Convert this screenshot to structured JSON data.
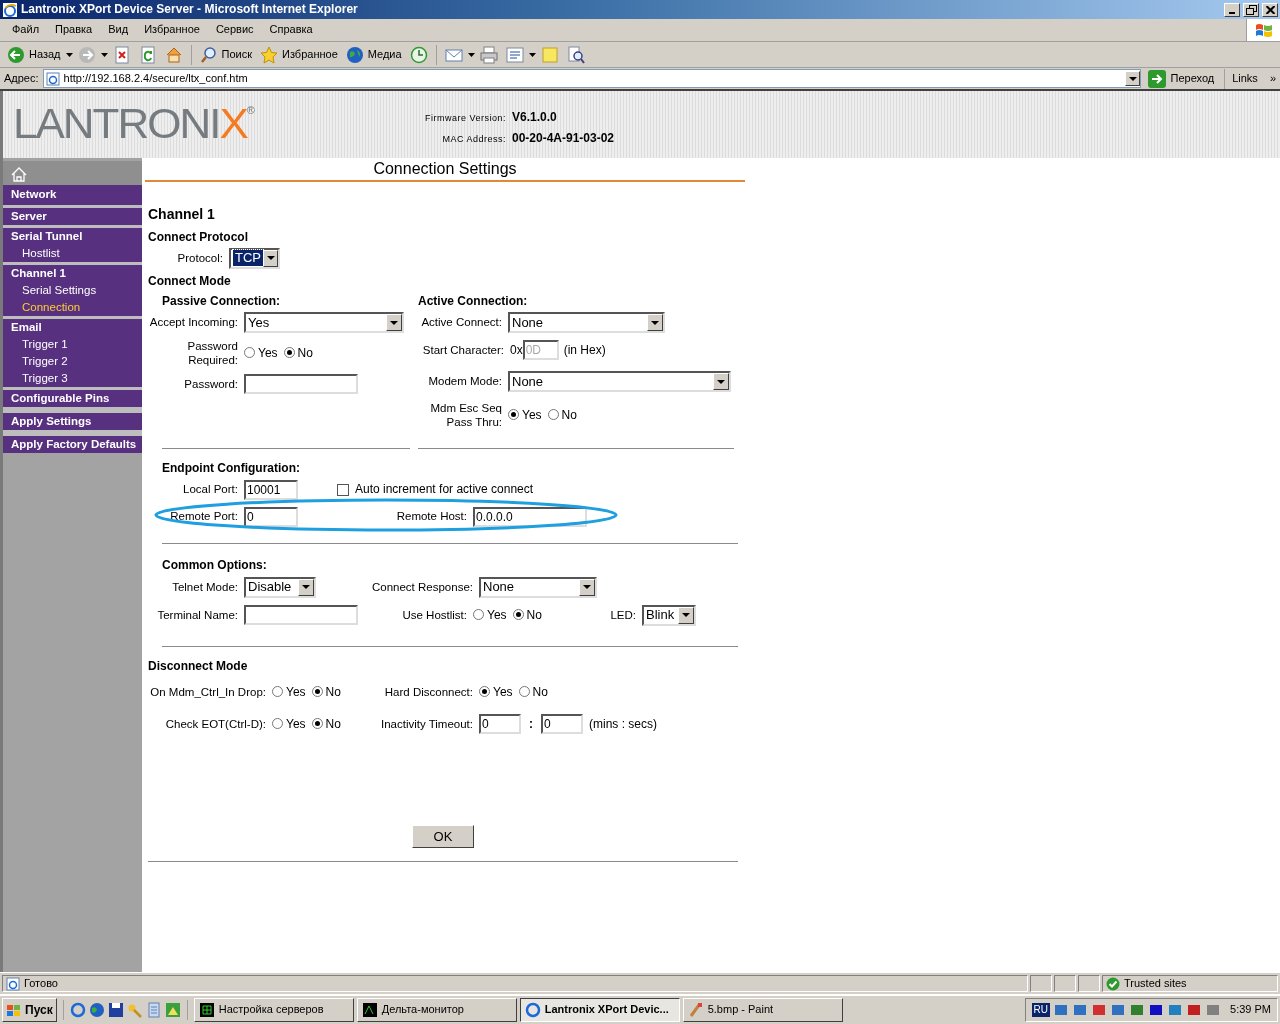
{
  "window": {
    "title": "Lantronix XPort Device Server - Microsoft Internet Explorer"
  },
  "menu": [
    "Файл",
    "Правка",
    "Вид",
    "Избранное",
    "Сервис",
    "Справка"
  ],
  "toolbar": [
    {
      "kind": "back",
      "label": "Назад"
    },
    {
      "kind": "forward"
    },
    {
      "kind": "stop"
    },
    {
      "kind": "refresh"
    },
    {
      "kind": "home"
    },
    {
      "kind": "search",
      "label": "Поиск"
    },
    {
      "kind": "favorites",
      "label": "Избранное"
    },
    {
      "kind": "media",
      "label": "Медиа"
    },
    {
      "kind": "history"
    },
    {
      "kind": "mail"
    },
    {
      "kind": "print"
    },
    {
      "kind": "edit"
    },
    {
      "kind": "note"
    },
    {
      "kind": "research"
    }
  ],
  "address": {
    "label": "Адрес:",
    "url": "http://192.168.2.4/secure/ltx_conf.htm",
    "go": "Переход",
    "links": "Links",
    "more": "»"
  },
  "header": {
    "logo": {
      "text": "LANTRONI",
      "accent": "X",
      "mark": "®"
    },
    "firmware_label": "Firmware Version:",
    "firmware": "V6.1.0.0",
    "mac_label": "MAC Address:",
    "mac": "00-20-4A-91-03-02"
  },
  "sidebar": {
    "items": [
      {
        "kind": "home",
        "selected": false
      },
      {
        "kind": "section",
        "label": "Network",
        "selected": false
      },
      {
        "kind": "section",
        "label": "Server",
        "selected": false
      },
      {
        "kind": "section",
        "label": "Serial Tunnel",
        "selected": false
      },
      {
        "kind": "sub",
        "label": "Hostlist",
        "selected": false
      },
      {
        "kind": "section",
        "label": "Channel 1",
        "selected": false
      },
      {
        "kind": "sub",
        "label": "Serial Settings",
        "selected": false
      },
      {
        "kind": "sub",
        "label": "Connection",
        "selected": true
      },
      {
        "kind": "section",
        "label": "Email",
        "selected": false
      },
      {
        "kind": "sub",
        "label": "Trigger 1",
        "selected": false
      },
      {
        "kind": "sub",
        "label": "Trigger 2",
        "selected": false
      },
      {
        "kind": "sub",
        "label": "Trigger 3",
        "selected": false
      },
      {
        "kind": "section",
        "label": "Configurable Pins",
        "selected": false
      },
      {
        "kind": "action",
        "label": "Apply Settings",
        "selected": false
      },
      {
        "kind": "action",
        "label": "Apply Factory Defaults",
        "selected": false
      }
    ]
  },
  "page_title": "Connection Settings",
  "form": {
    "channel": "Channel 1",
    "protocol_heading": "Connect Protocol",
    "protocol": {
      "label": "Protocol:",
      "value": "TCP",
      "highlighted": true
    },
    "mode_heading": "Connect Mode",
    "passive": {
      "heading": "Passive Connection:",
      "accept_incoming": {
        "label": "Accept Incoming:",
        "value": "Yes"
      },
      "password_required": {
        "label": "Password Required:",
        "options": [
          {
            "label": "Yes",
            "selected": false
          },
          {
            "label": "No",
            "selected": true
          }
        ]
      },
      "password": {
        "label": "Password:"
      }
    },
    "active": {
      "heading": "Active Connection:",
      "active_connect": {
        "label": "Active Connect:",
        "value": "None"
      },
      "start_character": {
        "label": "Start Character:",
        "prefix": "0x",
        "value": "0D",
        "disabled": true,
        "suffix": "(in Hex)"
      },
      "modem_mode": {
        "label": "Modem Mode:",
        "value": "None"
      },
      "esc_seq": {
        "label": "Mdm Esc Seq Pass Thru:",
        "options": [
          {
            "label": "Yes",
            "selected": true
          },
          {
            "label": "No",
            "selected": false
          }
        ]
      }
    },
    "endpoint": {
      "heading": "Endpoint Configuration:",
      "local_port": {
        "label": "Local Port:",
        "value": "10001"
      },
      "auto_increment": {
        "label": "Auto increment for active connect",
        "checked": false
      },
      "remote_port": {
        "label": "Remote Port:",
        "value": "0"
      },
      "remote_host": {
        "label": "Remote Host:",
        "value": "0.0.0.0"
      }
    },
    "common": {
      "heading": "Common Options:",
      "telnet_mode": {
        "label": "Telnet Mode:",
        "value": "Disable"
      },
      "connect_response": {
        "label": "Connect Response:",
        "value": "None"
      },
      "terminal_name": {
        "label": "Terminal Name:"
      },
      "use_hostlist": {
        "label": "Use Hostlist:",
        "options": [
          {
            "label": "Yes",
            "selected": false
          },
          {
            "label": "No",
            "selected": true
          }
        ]
      },
      "led": {
        "label": "LED:",
        "value": "Blink"
      }
    },
    "disconnect": {
      "heading": "Disconnect Mode",
      "mdm_ctrl": {
        "label": "On Mdm_Ctrl_In Drop:",
        "options": [
          {
            "label": "Yes",
            "selected": false
          },
          {
            "label": "No",
            "selected": true
          }
        ]
      },
      "hard_disconnect": {
        "label": "Hard Disconnect:",
        "options": [
          {
            "label": "Yes",
            "selected": true
          },
          {
            "label": "No",
            "selected": false
          }
        ]
      },
      "check_eot": {
        "label": "Check EOT(Ctrl-D):",
        "options": [
          {
            "label": "Yes",
            "selected": false
          },
          {
            "label": "No",
            "selected": true
          }
        ]
      },
      "inactivity": {
        "label": "Inactivity Timeout:",
        "minutes": "0",
        "separator": ":",
        "seconds": "0",
        "suffix": "(mins : secs)"
      }
    },
    "ok": "OK"
  },
  "status_bar": {
    "text": "Готово",
    "zone": "Trusted sites"
  },
  "taskbar": {
    "start": "Пуск",
    "tasks": [
      {
        "label": "Настройка серверов",
        "selected": false
      },
      {
        "label": "Дельта-монитор",
        "selected": false
      },
      {
        "label": "Lantronix XPort Devic...",
        "selected": true
      },
      {
        "label": "5.bmp - Paint",
        "selected": false
      }
    ],
    "lang": "RU",
    "clock": "5:39 PM"
  }
}
